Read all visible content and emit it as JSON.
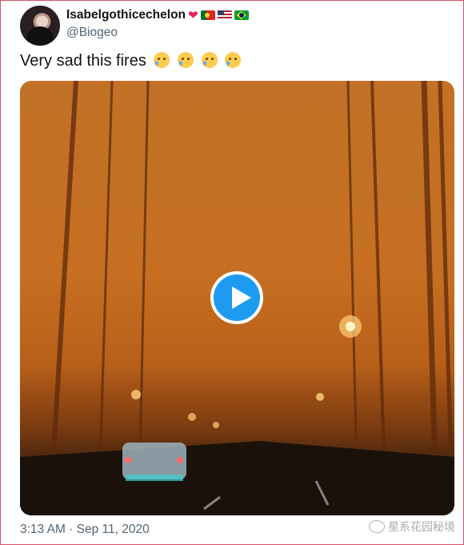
{
  "user": {
    "display_name": "Isabelgothicechelon",
    "handle": "@Biogeo",
    "badges": [
      "heart-icon",
      "flag-portugal-icon",
      "flag-usa-icon",
      "flag-brazil-icon"
    ]
  },
  "tweet": {
    "text": "Very sad this fires",
    "emoji": [
      "crying-face-icon",
      "crying-face-icon",
      "crying-face-icon",
      "crying-face-icon"
    ],
    "timestamp": "3:13 AM · Sep 11, 2020"
  },
  "media": {
    "type": "video",
    "play_icon": "play-icon",
    "tint": "#c66f22"
  },
  "watermark": {
    "text": "星系花园秘境"
  }
}
